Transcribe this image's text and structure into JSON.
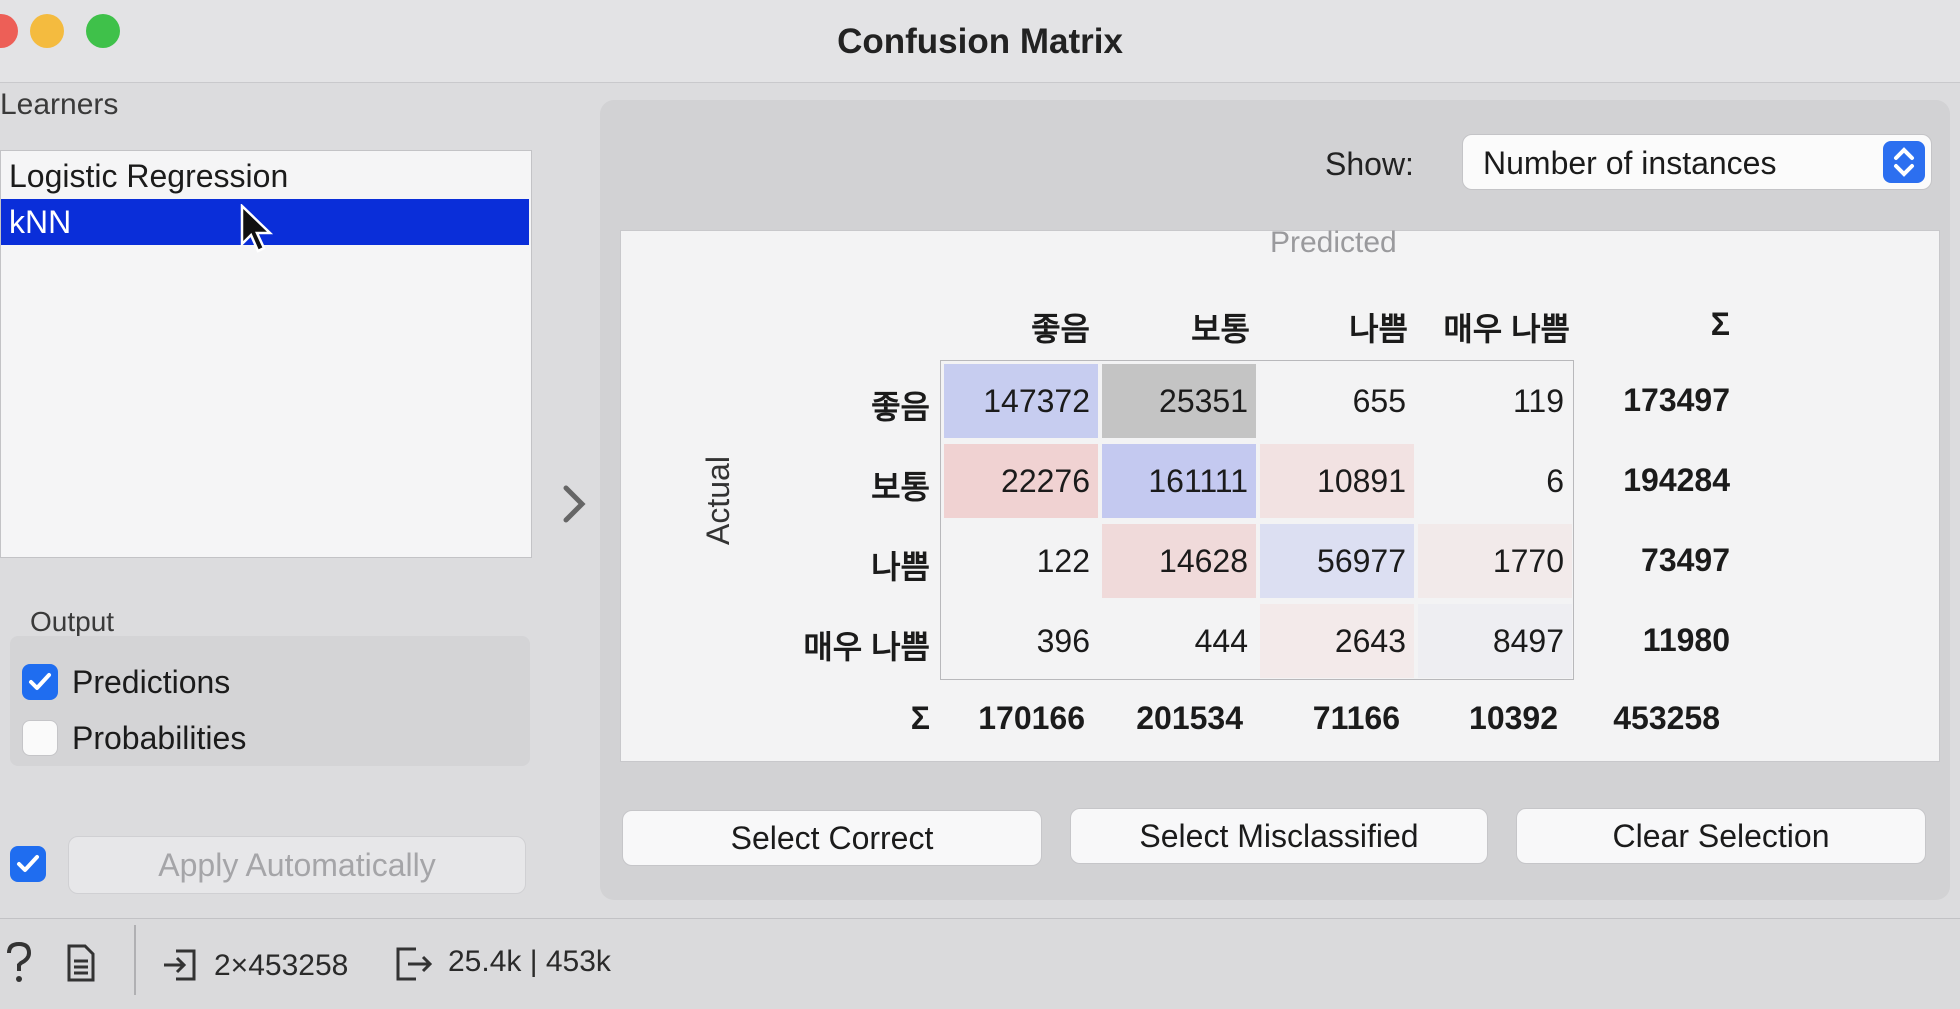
{
  "window": {
    "title": "Confusion Matrix"
  },
  "learners": {
    "label": "Learners",
    "items": [
      {
        "label": "Logistic Regression",
        "selected": false
      },
      {
        "label": "kNN",
        "selected": true
      }
    ]
  },
  "output": {
    "label": "Output",
    "predictions": {
      "label": "Predictions",
      "checked": true
    },
    "probabilities": {
      "label": "Probabilities",
      "checked": false
    }
  },
  "apply": {
    "label": "Apply Automatically",
    "checked": true
  },
  "show": {
    "label": "Show:",
    "value": "Number of instances"
  },
  "matrix": {
    "predicted_label": "Predicted",
    "actual_label": "Actual",
    "sum_symbol": "Σ",
    "columns": [
      "좋음",
      "보통",
      "나쁨",
      "매우 나쁨"
    ],
    "rows": [
      {
        "label": "좋음",
        "values": [
          "147372",
          "25351",
          "655",
          "119"
        ],
        "sum": "173497"
      },
      {
        "label": "보통",
        "values": [
          "22276",
          "161111",
          "10891",
          "6"
        ],
        "sum": "194284"
      },
      {
        "label": "나쁨",
        "values": [
          "122",
          "14628",
          "56977",
          "1770"
        ],
        "sum": "73497"
      },
      {
        "label": "매우 나쁨",
        "values": [
          "396",
          "444",
          "2643",
          "8497"
        ],
        "sum": "11980"
      }
    ],
    "column_sums": [
      "170166",
      "201534",
      "71166",
      "10392"
    ],
    "total": "453258"
  },
  "buttons": {
    "select_correct": "Select Correct",
    "select_misclassified": "Select Misclassified",
    "clear_selection": "Clear Selection"
  },
  "status": {
    "input": "2×453258",
    "output": "25.4k | 453k"
  },
  "colors": {
    "selected_row": "#0a2ed9",
    "checkbox": "#1f6df0",
    "correct_cell": "#c7cdf0",
    "misclassified_cell": "#f0d2d2",
    "highlight_gray": "#c4c4c4"
  }
}
